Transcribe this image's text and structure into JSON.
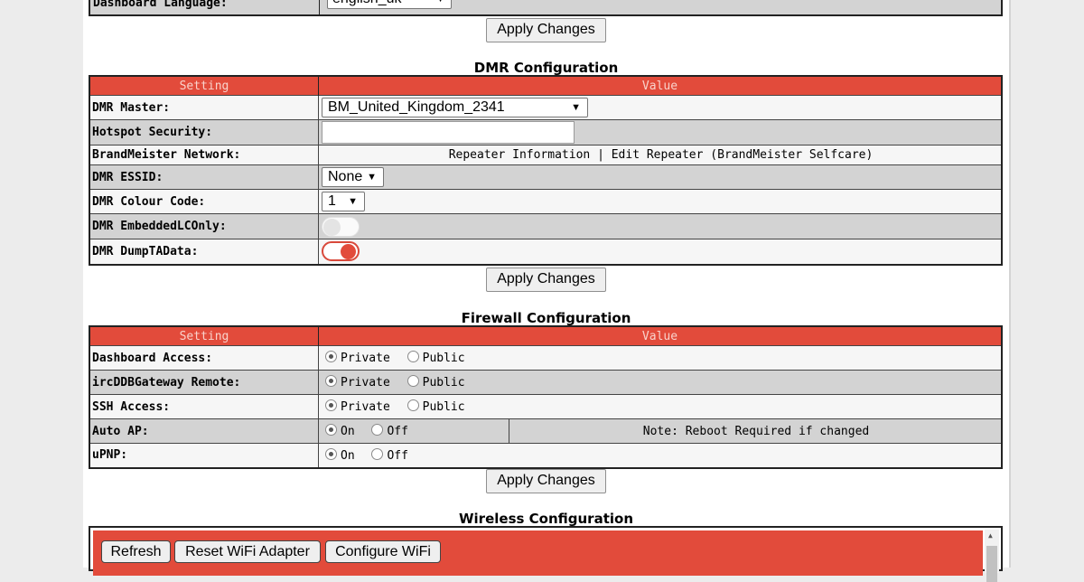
{
  "language": {
    "label": "Dashboard Language:",
    "value": "english_uk"
  },
  "apply_label": "Apply Changes",
  "dmr": {
    "title": "DMR Configuration",
    "col_setting": "Setting",
    "col_value": "Value",
    "master_label": "DMR Master:",
    "master_value": "BM_United_Kingdom_2341",
    "security_label": "Hotspot Security:",
    "security_value": "",
    "network_label": "BrandMeister Network:",
    "repeater_info": "Repeater Information",
    "separator": "|",
    "edit_repeater": "Edit Repeater (BrandMeister Selfcare)",
    "essid_label": "DMR ESSID:",
    "essid_value": "None",
    "colour_label": "DMR Colour Code:",
    "colour_value": "1",
    "embedded_label": "DMR EmbeddedLCOnly:",
    "embedded_on": false,
    "dumpta_label": "DMR DumpTAData:",
    "dumpta_on": true
  },
  "firewall": {
    "title": "Firewall Configuration",
    "col_setting": "Setting",
    "col_value": "Value",
    "private": "Private",
    "public": "Public",
    "on": "On",
    "off": "Off",
    "dashboard_label": "Dashboard Access:",
    "ircddb_label": "ircDDBGateway Remote:",
    "ssh_label": "SSH Access:",
    "autoap_label": "Auto AP:",
    "autoap_note": "Note: Reboot Required if changed",
    "upnp_label": "uPNP:"
  },
  "wireless": {
    "title": "Wireless Configuration",
    "refresh": "Refresh",
    "reset": "Reset WiFi Adapter",
    "configure": "Configure WiFi"
  },
  "colors": {
    "accent": "#e24b3b",
    "header_text": "#f9d3cc",
    "row_grey": "#d3d3d3"
  }
}
